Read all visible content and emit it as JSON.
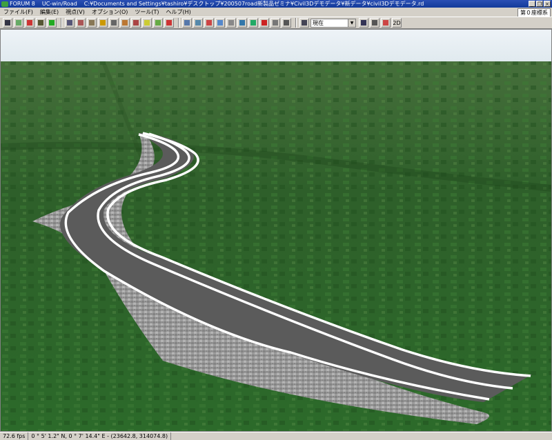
{
  "window": {
    "brand": "FORUM 8",
    "app": "UC-win/Road",
    "path": "C:¥Documents and Settings¥tashiro¥デスクトップ¥200507road新製品ゼミナ¥Civil3Dデモデータ¥新データ¥civil3Dデモデータ.rd",
    "controls": [
      "_",
      "❐",
      "×"
    ]
  },
  "menu": {
    "items": [
      "ファイル(F)",
      "編集(E)",
      "視点(V)",
      "オプション(O)",
      "ツール(T)",
      "ヘルプ(H)"
    ],
    "coord_system": "第０座標系"
  },
  "toolbar": {
    "viewpoint_select": "現在",
    "btn_2d": "2D",
    "icons": [
      {
        "name": "road-edit-icon",
        "color": "#334"
      },
      {
        "name": "terrain-icon",
        "color": "#6a6"
      },
      {
        "name": "person-icon",
        "color": "#c33"
      },
      {
        "name": "intersection-icon",
        "color": "#553"
      },
      {
        "name": "tree-icon",
        "color": "#2a2"
      },
      {
        "name": "image-icon",
        "color": "#557"
      },
      {
        "name": "cube-icon",
        "color": "#a55"
      },
      {
        "name": "building-icon",
        "color": "#875"
      },
      {
        "name": "sign-icon",
        "color": "#c90"
      },
      {
        "name": "cross-section-icon",
        "color": "#666"
      },
      {
        "name": "model-icon",
        "color": "#b73"
      },
      {
        "name": "traffic-icon",
        "color": "#a44"
      },
      {
        "name": "light-icon",
        "color": "#cc3"
      },
      {
        "name": "weather-icon",
        "color": "#6a4"
      },
      {
        "name": "scenario-icon",
        "color": "#c33"
      },
      {
        "name": "navigate-icon",
        "color": "#57a"
      },
      {
        "name": "walk-icon",
        "color": "#58a"
      },
      {
        "name": "move-icon",
        "color": "#c44"
      },
      {
        "name": "fly-icon",
        "color": "#58c"
      },
      {
        "name": "drive-icon",
        "color": "#888"
      },
      {
        "name": "rotate-icon",
        "color": "#37a"
      },
      {
        "name": "car-icon",
        "color": "#2a6"
      },
      {
        "name": "pause-icon",
        "color": "#c22"
      },
      {
        "name": "record-icon",
        "color": "#777"
      },
      {
        "name": "script-icon",
        "color": "#555"
      },
      {
        "name": "view-icon",
        "color": "#335"
      },
      {
        "name": "settings-icon",
        "color": "#555"
      },
      {
        "name": "flag-icon",
        "color": "#c44"
      }
    ]
  },
  "status": {
    "fps": "72.6 fps",
    "position": "0 ° 5' 1.2\" N, 0 ° 7' 14.4\" E  -  (23642.8, 314074.8)"
  },
  "colors": {
    "sky_top": "#e6eef4",
    "sky_bottom": "#dde8ee",
    "terrain_near": "#2f6a2b",
    "terrain_far": "#3e6e34",
    "asphalt": "#5c5c5c",
    "lane_marking": "#ffffff",
    "embankment": "#9c9c9c"
  }
}
